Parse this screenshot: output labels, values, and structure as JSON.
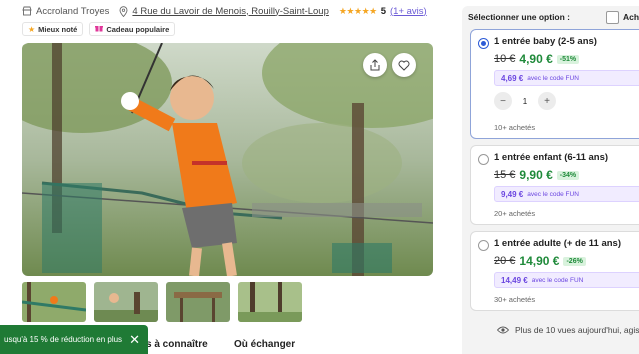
{
  "header": {
    "place_name": "Accroland Troyes",
    "address": "4 Rue du Lavoir de Menois, Rouilly-Saint-Loup",
    "stars": "★★★★★",
    "rating": "5",
    "reviews": "(1+ avis)"
  },
  "badges": [
    {
      "label": "Mieux noté",
      "icon": "star-icon",
      "color": "#f5a623"
    },
    {
      "label": "Cadeau populaire",
      "icon": "gift-icon",
      "color": "#e0379a"
    }
  ],
  "tabs": [
    {
      "label": "s à connaître"
    },
    {
      "label": "Où échanger"
    }
  ],
  "toast": {
    "text": "usqu'à 15 % de réduction en plus",
    "close": "✕",
    "color": "#1f7a35"
  },
  "panel": {
    "heading": "Sélectionner une option :",
    "side_label": "Ache",
    "options": [
      {
        "title": "1 entrée baby (2-5 ans)",
        "old_price": "10 €",
        "new_price": "4,90 €",
        "discount": "-51%",
        "code_price": "4,69 €",
        "code_text": "avec le code FUN",
        "quantity": "1",
        "minus": "−",
        "plus": "+",
        "sold": "10+ achetés",
        "selected": true
      },
      {
        "title": "1 entrée enfant (6-11 ans)",
        "old_price": "15 €",
        "new_price": "9,90 €",
        "discount": "-34%",
        "code_price": "9,49 €",
        "code_text": "avec le code FUN",
        "sold": "20+ achetés",
        "selected": false
      },
      {
        "title": "1 entrée adulte (+ de 11 ans)",
        "old_price": "20 €",
        "new_price": "14,90 €",
        "discount": "-26%",
        "code_price": "14,49 €",
        "code_text": "avec le code FUN",
        "sold": "30+ achetés",
        "selected": false
      }
    ],
    "views_text": "Plus de 10 vues aujourd'hui, agis"
  },
  "colors": {
    "accent_purple": "#6b46e0",
    "price_green": "#1f8a3a",
    "radio_blue": "#2d5bd6"
  }
}
